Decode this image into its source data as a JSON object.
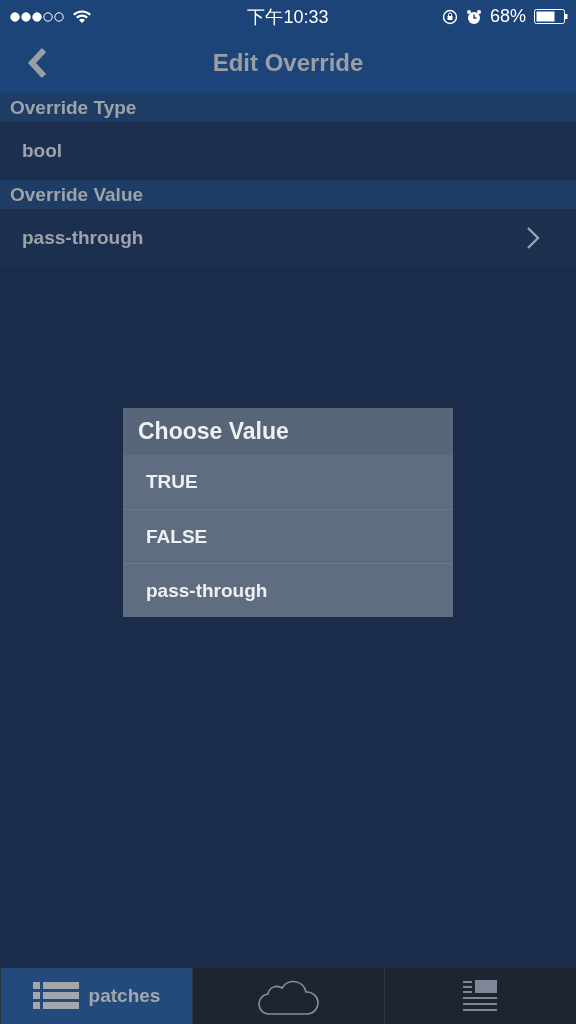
{
  "status_bar": {
    "time": "下午10:33",
    "battery": "68%"
  },
  "nav": {
    "title": "Edit Override"
  },
  "sections": [
    {
      "header": "Override Type",
      "value": "bool",
      "disclosure": false
    },
    {
      "header": "Override Value",
      "value": "pass-through",
      "disclosure": true
    }
  ],
  "dialog": {
    "title": "Choose Value",
    "options": [
      "TRUE",
      "FALSE",
      "pass-through"
    ]
  },
  "tabs": [
    {
      "kind": "list",
      "label": "patches",
      "selected": true
    },
    {
      "kind": "cloud",
      "selected": false
    },
    {
      "kind": "doc",
      "selected": false
    }
  ]
}
